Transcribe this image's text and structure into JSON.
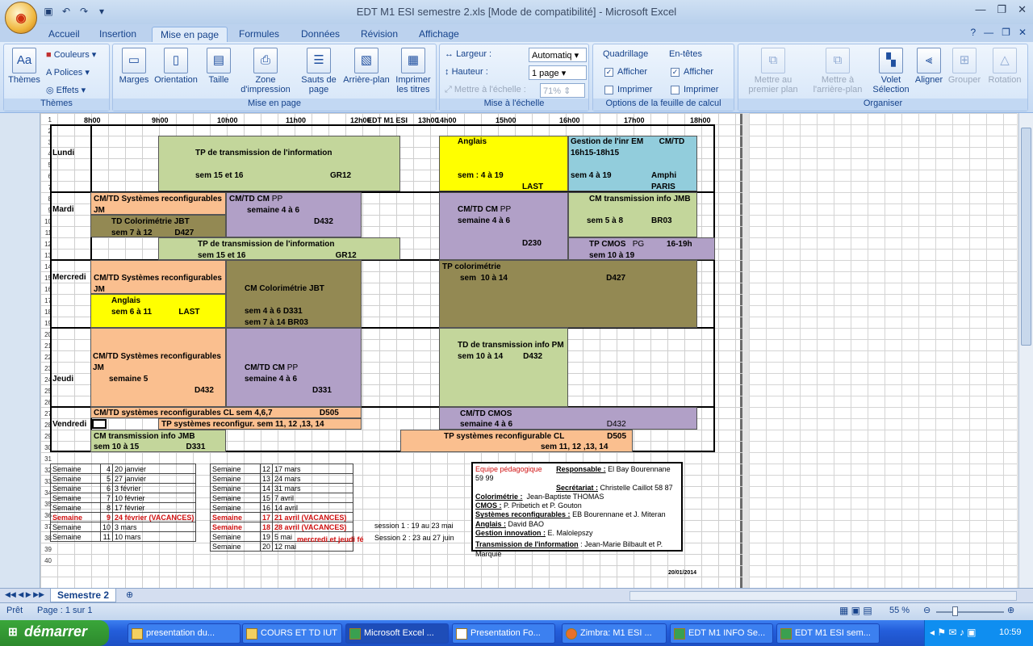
{
  "window": {
    "title": "EDT M1 ESI semestre 2.xls  [Mode de compatibilité] - Microsoft Excel"
  },
  "ribbon_tabs": [
    "Accueil",
    "Insertion",
    "Mise en page",
    "Formules",
    "Données",
    "Révision",
    "Affichage"
  ],
  "ribbon": {
    "themes": {
      "label": "Thèmes",
      "themes_btn": "Thèmes",
      "couleurs": "Couleurs",
      "polices": "Polices",
      "effets": "Effets"
    },
    "mise_en_page": {
      "label": "Mise en page",
      "marges": "Marges",
      "orientation": "Orientation",
      "taille": "Taille",
      "zone": "Zone d'impression",
      "sauts": "Sauts de page",
      "arriere": "Arrière-plan",
      "imprimer_titres": "Imprimer les titres"
    },
    "echelle": {
      "label": "Mise à l'échelle",
      "largeur": "Largeur :",
      "largeur_val": "Automatiq",
      "hauteur": "Hauteur :",
      "hauteur_val": "1 page",
      "mettre": "Mettre à l'échelle :",
      "mettre_val": "71%"
    },
    "options": {
      "label": "Options de la feuille de calcul",
      "quadrillage": "Quadrillage",
      "entetes": "En-têtes",
      "afficher": "Afficher",
      "imprimer": "Imprimer"
    },
    "organiser": {
      "label": "Organiser",
      "premier": "Mettre au premier plan",
      "arriere": "Mettre à l'arrière-plan",
      "volet": "Volet Sélection",
      "aligner": "Aligner",
      "grouper": "Grouper",
      "rotation": "Rotation"
    }
  },
  "schedule": {
    "hours": [
      "8h00",
      "9h00",
      "10h00",
      "11h00",
      "12h00",
      "13h00",
      "14h00",
      "15h00",
      "16h00",
      "17h00",
      "18h00"
    ],
    "header_title": "EDT M1 ESI",
    "days": [
      "Lundi",
      "Mardi",
      "Mercredi",
      "Jeudi",
      "Vendredi"
    ]
  },
  "cal1": [
    [
      "Semaine",
      "4",
      "20 janvier"
    ],
    [
      "Semaine",
      "5",
      "27 janvier"
    ],
    [
      "Semaine",
      "6",
      "3 février"
    ],
    [
      "Semaine",
      "7",
      "10 février"
    ],
    [
      "Semaine",
      "8",
      "17 février"
    ],
    [
      "Semaine",
      "9",
      "24 février (VACANCES)"
    ],
    [
      "Semaine",
      "10",
      "3 mars"
    ],
    [
      "Semaine",
      "11",
      "10 mars"
    ]
  ],
  "cal2": [
    [
      "Semaine",
      "12",
      "17 mars"
    ],
    [
      "Semaine",
      "13",
      "24 mars"
    ],
    [
      "Semaine",
      "14",
      "31 mars"
    ],
    [
      "Semaine",
      "15",
      "7 avril"
    ],
    [
      "Semaine",
      "16",
      "14 avril"
    ],
    [
      "Semaine",
      "17",
      "21 avril (VACANCES)"
    ],
    [
      "Semaine",
      "18",
      "28 avril (VACANCES)"
    ],
    [
      "Semaine",
      "19",
      "5 mai"
    ],
    [
      "Semaine",
      "20",
      "12 mai"
    ]
  ],
  "notes": {
    "mercredi": "mercredi et jeudi fé",
    "session1": "session 1 : 19 au 23 mai",
    "session2": "Session 2 : 23 au 27 juin",
    "date": "20/01/2014"
  },
  "equipe": {
    "title": "Equipe pédagogique",
    "lines": [
      [
        "Responsable :",
        "El Bay Bourennane 59 99"
      ],
      [
        "Secrétariat :",
        "Christelle Caillot 58 87"
      ],
      [
        "Colorimétrie :",
        "Jean-Baptiste THOMAS"
      ],
      [
        "CMOS :",
        "P. Pribetich et P. Gouton"
      ],
      [
        "Systèmes reconfigurables :",
        "EB Bourennane et J. Miteran"
      ],
      [
        "Anglais :",
        "David BAO"
      ],
      [
        "Gestion innovation :",
        "E. Malolepszy"
      ],
      [
        "Transmission de l'information",
        "Jean-Marie Bilbault et P. Marquié"
      ]
    ]
  },
  "sheet_tab": "Semestre 2",
  "status": {
    "ready": "Prêt",
    "page": "Page : 1 sur 1",
    "zoom": "55 %"
  },
  "taskbar": {
    "start": "démarrer",
    "items": [
      "presentation du...",
      "COURS ET TD IUT",
      "Microsoft Excel ...",
      "Presentation Fo...",
      "Zimbra: M1 ESI ...",
      "EDT M1 INFO Se...",
      "EDT M1 ESI sem..."
    ],
    "clock": "10:59"
  }
}
